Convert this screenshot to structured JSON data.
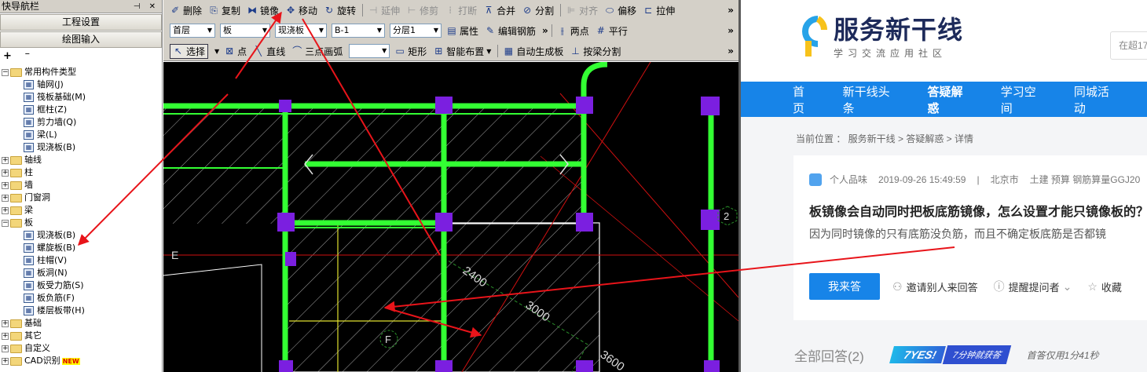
{
  "nav": {
    "title": "快导航栏",
    "pin_glyphs": "⊣ ✕",
    "btn_project": "工程设置",
    "btn_drawing": "绘图输入",
    "tools": "+ ⁻",
    "tree": [
      {
        "label": "常用构件类型",
        "level": 0,
        "folder": true,
        "expanded": true
      },
      {
        "label": "轴网(J)",
        "level": 1
      },
      {
        "label": "筏板基础(M)",
        "level": 1
      },
      {
        "label": "框柱(Z)",
        "level": 1
      },
      {
        "label": "剪力墙(Q)",
        "level": 1
      },
      {
        "label": "梁(L)",
        "level": 1
      },
      {
        "label": "现浇板(B)",
        "level": 1
      },
      {
        "label": "轴线",
        "level": 0,
        "folder": true
      },
      {
        "label": "柱",
        "level": 0,
        "folder": true
      },
      {
        "label": "墙",
        "level": 0,
        "folder": true
      },
      {
        "label": "门窗洞",
        "level": 0,
        "folder": true
      },
      {
        "label": "梁",
        "level": 0,
        "folder": true
      },
      {
        "label": "板",
        "level": 0,
        "folder": true,
        "expanded": true
      },
      {
        "label": "现浇板(B)",
        "level": 1
      },
      {
        "label": "螺旋板(B)",
        "level": 1
      },
      {
        "label": "柱帽(V)",
        "level": 1
      },
      {
        "label": "板洞(N)",
        "level": 1
      },
      {
        "label": "板受力筋(S)",
        "level": 1
      },
      {
        "label": "板负筋(F)",
        "level": 1
      },
      {
        "label": "楼层板带(H)",
        "level": 1
      },
      {
        "label": "基础",
        "level": 0,
        "folder": true
      },
      {
        "label": "其它",
        "level": 0,
        "folder": true
      },
      {
        "label": "自定义",
        "level": 0,
        "folder": true
      },
      {
        "label": "CAD识别",
        "level": 0,
        "folder": true,
        "badge": "NEW"
      }
    ]
  },
  "toolbar1": {
    "items": [
      "删除",
      "复制",
      "镜像",
      "移动",
      "旋转",
      "延伸",
      "修剪",
      "打断",
      "合并",
      "分割",
      "对齐",
      "偏移",
      "拉伸"
    ],
    "disabled": [
      "延伸",
      "修剪",
      "打断",
      "对齐"
    ],
    "more": "»"
  },
  "toolbar2": {
    "floor": "首层",
    "category": "板",
    "type": "现浇板",
    "name": "B-1",
    "layer": "分层1",
    "props": "属性",
    "edit_rebar": "编辑钢筋",
    "two_point": "两点",
    "parallel": "平行",
    "more": "»"
  },
  "toolbar3": {
    "select": "选择",
    "point": "点",
    "line": "直线",
    "arc": "三点画弧",
    "arc_value": "",
    "rect": "矩形",
    "smart": "智能布置",
    "auto": "自动生成板",
    "split": "按梁分割",
    "more": "»"
  },
  "canvas": {
    "dims": [
      "2400",
      "3000",
      "3600"
    ],
    "axis_labels": [
      "E",
      "F",
      "2"
    ]
  },
  "web": {
    "logo_name": "服务新干线",
    "logo_sub": "学习交流应用社区",
    "search_placeholder": "在超17",
    "menu": [
      "首页",
      "新干线头条",
      "答疑解惑",
      "学习空间",
      "同城活动"
    ],
    "active_menu": "答疑解惑",
    "breadcrumb": "当前位置 ： 服务新干线 > 答疑解惑 > 详情",
    "author": "个人品味",
    "date": "2019-09-26 15:49:59",
    "sep": "|",
    "location": "北京市",
    "tags": "土建 预算 钢筋算量GGJ20",
    "question_title": "板镜像会自动同时把板底筋镜像，怎么设置才能只镜像板的？",
    "question_desc": "因为同时镜像的只有底筋没负筋，而且不确定板底筋是否都镜",
    "btn_answer": "我来答",
    "invite": "邀请别人来回答",
    "remind": "提醒提问者",
    "collect": "收藏",
    "answers": "全部回答(2)",
    "promo_yes": "7YES!",
    "promo_fast": "7分钟就获答",
    "promo_note": "首答仅用1分41秒"
  },
  "colors": {
    "menu_blue": "#1784e8",
    "wall_green": "#33ff33",
    "column_purple": "#7b1fe0",
    "arrow_red": "#e8141a"
  }
}
